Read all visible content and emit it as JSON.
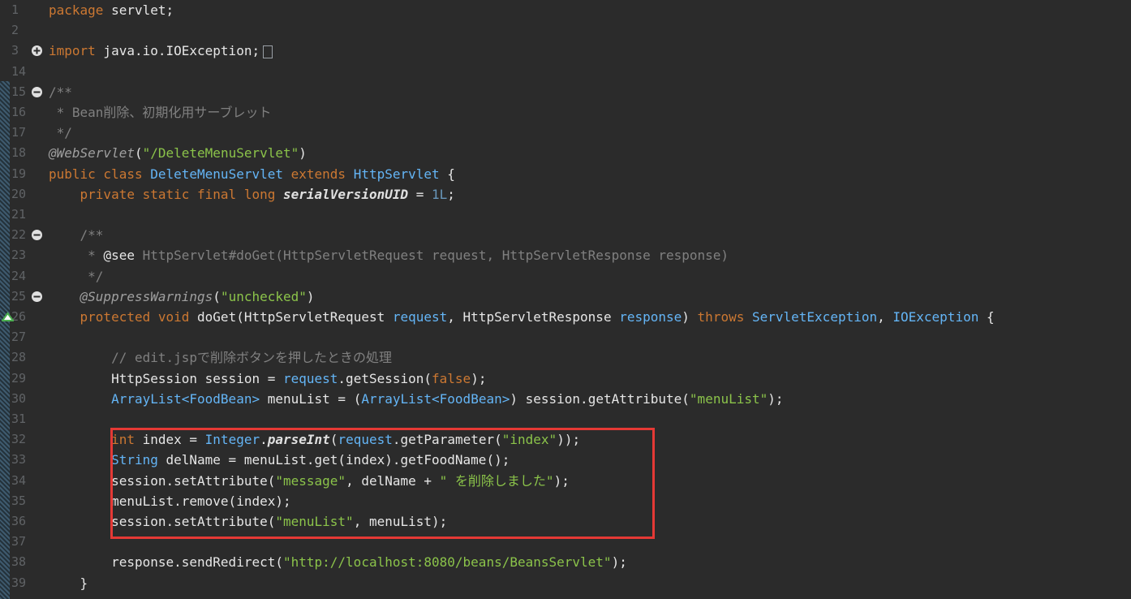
{
  "editor": {
    "highlight_color": "#e53935",
    "lines": [
      {
        "num": "1",
        "marker": "",
        "segments": [
          {
            "c": "kw",
            "t": "package"
          },
          {
            "c": "plain",
            "t": " servlet;"
          }
        ]
      },
      {
        "num": "2",
        "marker": "",
        "segments": []
      },
      {
        "num": "3",
        "marker": "plus-icon",
        "segments": [
          {
            "c": "kw",
            "t": "import"
          },
          {
            "c": "plain",
            "t": " java.io.IOException;"
          }
        ],
        "fold_box": true
      },
      {
        "num": "14",
        "marker": "",
        "segments": []
      },
      {
        "num": "15",
        "marker": "minus-icon",
        "segments": [
          {
            "c": "cm",
            "t": "/**"
          }
        ]
      },
      {
        "num": "16",
        "marker": "",
        "segments": [
          {
            "c": "cm",
            "t": " * Bean削除、初期化用サーブレット"
          }
        ]
      },
      {
        "num": "17",
        "marker": "",
        "segments": [
          {
            "c": "cm",
            "t": " */"
          }
        ]
      },
      {
        "num": "18",
        "marker": "",
        "segments": [
          {
            "c": "ann",
            "t": "@WebServlet"
          },
          {
            "c": "plain",
            "t": "("
          },
          {
            "c": "str",
            "t": "\"/DeleteMenuServlet\""
          },
          {
            "c": "plain",
            "t": ")"
          }
        ]
      },
      {
        "num": "19",
        "marker": "",
        "segments": [
          {
            "c": "kw",
            "t": "public class "
          },
          {
            "c": "type",
            "t": "DeleteMenuServlet"
          },
          {
            "c": "kw",
            "t": " extends "
          },
          {
            "c": "type",
            "t": "HttpServlet"
          },
          {
            "c": "plain",
            "t": " {"
          }
        ]
      },
      {
        "num": "20",
        "marker": "",
        "segments": [
          {
            "c": "kw",
            "t": "    private static final long "
          },
          {
            "c": "fld",
            "t": "serialVersionUID"
          },
          {
            "c": "plain",
            "t": " = "
          },
          {
            "c": "num",
            "t": "1L"
          },
          {
            "c": "plain",
            "t": ";"
          }
        ]
      },
      {
        "num": "21",
        "marker": "",
        "segments": []
      },
      {
        "num": "22",
        "marker": "minus-icon",
        "segments": [
          {
            "c": "cm",
            "t": "    /**"
          }
        ]
      },
      {
        "num": "23",
        "marker": "",
        "segments": [
          {
            "c": "cm",
            "t": "     * "
          },
          {
            "c": "plain",
            "t": "@see"
          },
          {
            "c": "cm",
            "t": " HttpServlet#doGet(HttpServletRequest request, HttpServletResponse response)"
          }
        ]
      },
      {
        "num": "24",
        "marker": "",
        "segments": [
          {
            "c": "cm",
            "t": "     */"
          }
        ]
      },
      {
        "num": "25",
        "marker": "minus-icon",
        "segments": [
          {
            "c": "ann",
            "t": "    @SuppressWarnings"
          },
          {
            "c": "plain",
            "t": "("
          },
          {
            "c": "str",
            "t": "\"unchecked\""
          },
          {
            "c": "plain",
            "t": ")"
          }
        ]
      },
      {
        "num": "26",
        "marker": "override-icon",
        "segments": [
          {
            "c": "kw",
            "t": "    protected void "
          },
          {
            "c": "plain",
            "t": "doGet("
          },
          {
            "c": "plain",
            "t": "HttpServletRequest"
          },
          {
            "c": "type",
            "t": " request"
          },
          {
            "c": "plain",
            "t": ", HttpServletResponse"
          },
          {
            "c": "type",
            "t": " response"
          },
          {
            "c": "plain",
            "t": ") "
          },
          {
            "c": "kw",
            "t": "throws "
          },
          {
            "c": "type",
            "t": "ServletException"
          },
          {
            "c": "plain",
            "t": ", "
          },
          {
            "c": "type",
            "t": "IOException"
          },
          {
            "c": "plain",
            "t": " {"
          }
        ]
      },
      {
        "num": "27",
        "marker": "",
        "segments": []
      },
      {
        "num": "28",
        "marker": "",
        "segments": [
          {
            "c": "cm",
            "t": "        // edit.jspで削除ボタンを押したときの処理"
          }
        ]
      },
      {
        "num": "29",
        "marker": "",
        "segments": [
          {
            "c": "plain",
            "t": "        HttpSession session = "
          },
          {
            "c": "type",
            "t": "request"
          },
          {
            "c": "plain",
            "t": ".getSession("
          },
          {
            "c": "kw",
            "t": "false"
          },
          {
            "c": "plain",
            "t": ");"
          }
        ]
      },
      {
        "num": "30",
        "marker": "",
        "segments": [
          {
            "c": "type",
            "t": "        ArrayList<FoodBean>"
          },
          {
            "c": "plain",
            "t": " menuList = ("
          },
          {
            "c": "type",
            "t": "ArrayList<FoodBean>"
          },
          {
            "c": "plain",
            "t": ") session.getAttribute("
          },
          {
            "c": "str",
            "t": "\"menuList\""
          },
          {
            "c": "plain",
            "t": ");"
          }
        ]
      },
      {
        "num": "31",
        "marker": "",
        "segments": []
      },
      {
        "num": "32",
        "marker": "",
        "segments": [
          {
            "c": "kw",
            "t": "        int"
          },
          {
            "c": "plain",
            "t": " index = "
          },
          {
            "c": "type",
            "t": "Integer"
          },
          {
            "c": "plain",
            "t": "."
          },
          {
            "c": "sm",
            "t": "parseInt"
          },
          {
            "c": "plain",
            "t": "("
          },
          {
            "c": "type",
            "t": "request"
          },
          {
            "c": "plain",
            "t": ".getParameter("
          },
          {
            "c": "str",
            "t": "\"index\""
          },
          {
            "c": "plain",
            "t": "));"
          }
        ]
      },
      {
        "num": "33",
        "marker": "",
        "segments": [
          {
            "c": "type",
            "t": "        String"
          },
          {
            "c": "plain",
            "t": " delName = menuList.get(index).getFoodName();"
          }
        ]
      },
      {
        "num": "34",
        "marker": "",
        "segments": [
          {
            "c": "plain",
            "t": "        session.setAttribute("
          },
          {
            "c": "str",
            "t": "\"message\""
          },
          {
            "c": "plain",
            "t": ", delName + "
          },
          {
            "c": "str",
            "t": "\" を削除しました\""
          },
          {
            "c": "plain",
            "t": ");"
          }
        ]
      },
      {
        "num": "35",
        "marker": "",
        "segments": [
          {
            "c": "plain",
            "t": "        menuList.remove(index);"
          }
        ]
      },
      {
        "num": "36",
        "marker": "",
        "segments": [
          {
            "c": "plain",
            "t": "        session.setAttribute("
          },
          {
            "c": "str",
            "t": "\"menuList\""
          },
          {
            "c": "plain",
            "t": ", menuList);"
          }
        ]
      },
      {
        "num": "37",
        "marker": "",
        "segments": []
      },
      {
        "num": "38",
        "marker": "",
        "segments": [
          {
            "c": "plain",
            "t": "        response.sendRedirect("
          },
          {
            "c": "str",
            "t": "\"http://localhost:8080/beans/BeansServlet\""
          },
          {
            "c": "plain",
            "t": ");"
          }
        ]
      },
      {
        "num": "39",
        "marker": "",
        "segments": [
          {
            "c": "plain",
            "t": "    }"
          }
        ]
      }
    ]
  }
}
